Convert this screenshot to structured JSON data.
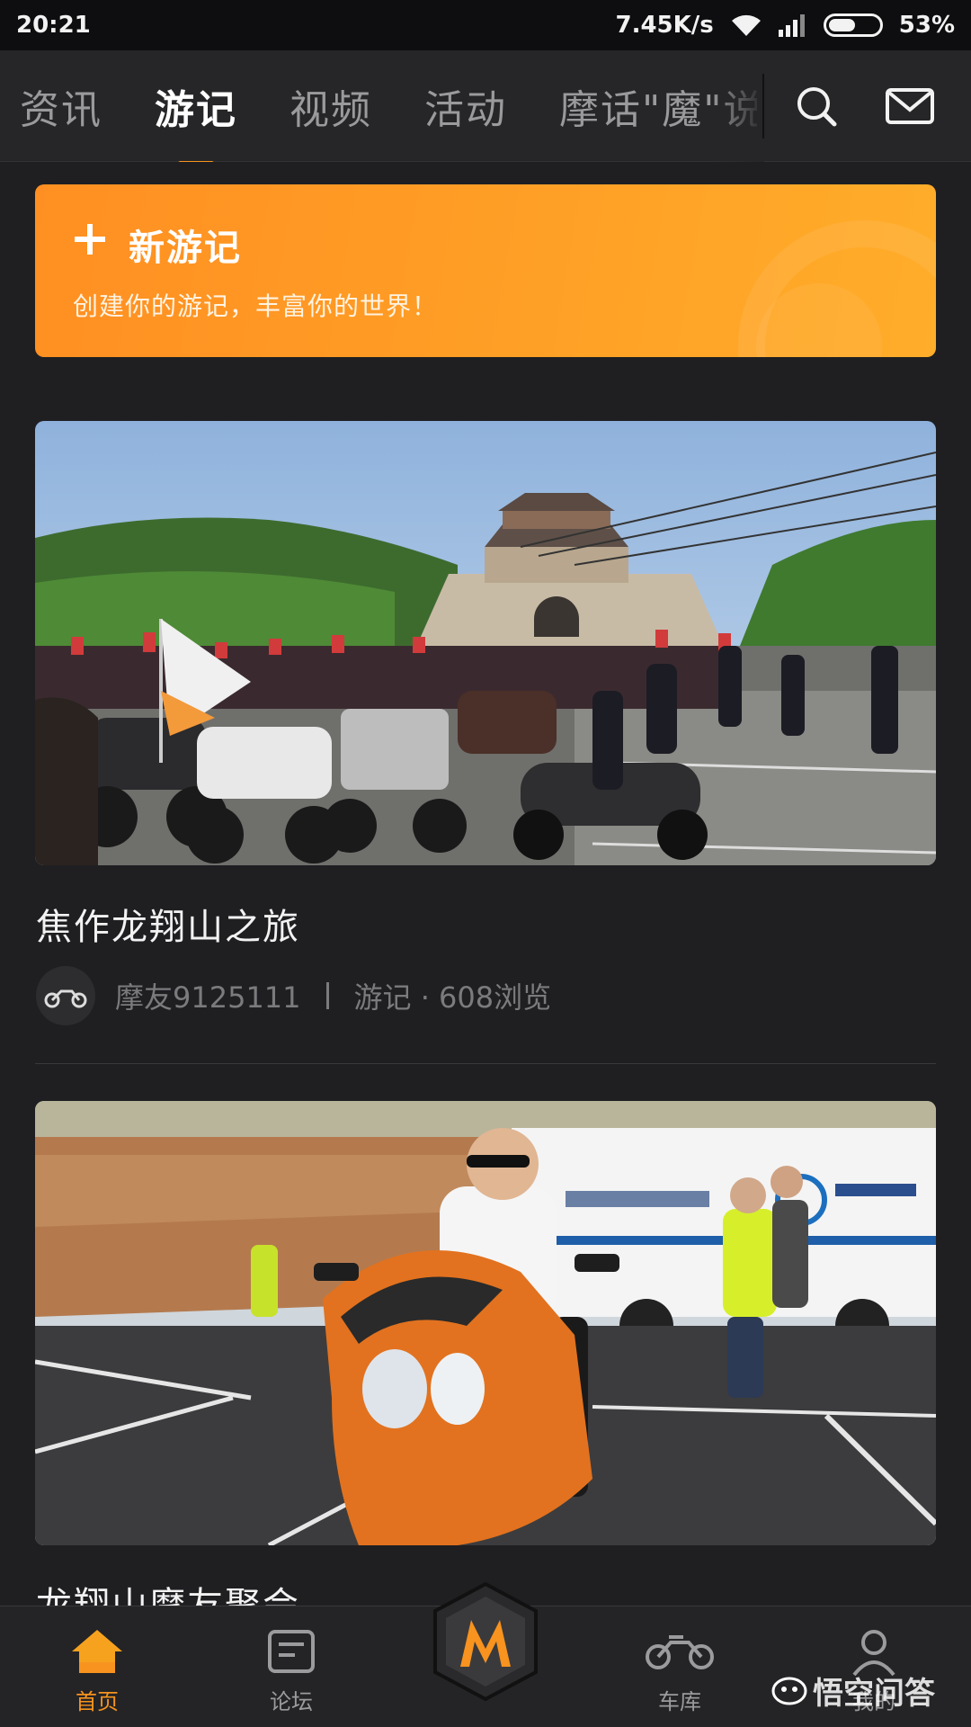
{
  "status_bar": {
    "time": "20:21",
    "network_speed": "7.45K/s",
    "battery_percent": "53%",
    "battery_level": 0.53
  },
  "top_nav": {
    "tabs": [
      {
        "label": "资讯"
      },
      {
        "label": "游记"
      },
      {
        "label": "视频"
      },
      {
        "label": "活动"
      },
      {
        "label": "摩话\"魔\"说"
      }
    ],
    "active_tab": "游记",
    "icons": [
      "search-icon",
      "mail-icon"
    ]
  },
  "banner": {
    "title": "新游记",
    "subtitle": "创建你的游记，丰富你的世界！"
  },
  "posts": [
    {
      "title": "焦作龙翔山之旅",
      "author": "摩友9125111",
      "category_views": "游记 · 608浏览",
      "image": "motorcycle-rally-photo"
    },
    {
      "title": "龙翔山摩友聚会",
      "image": "orange-motorcycle-photo"
    }
  ],
  "bottom_nav": {
    "items": [
      {
        "label": "首页",
        "icon": "home-icon",
        "active": true
      },
      {
        "label": "论坛",
        "icon": "forum-icon",
        "active": false
      },
      {
        "label": "",
        "icon": "m-logo-icon",
        "active": false
      },
      {
        "label": "车库",
        "icon": "motorcycle-icon",
        "active": false
      },
      {
        "label": "我的",
        "icon": "user-icon",
        "active": false
      }
    ]
  },
  "watermark": "悟空问答",
  "colors": {
    "accent": "#f7931e",
    "background": "#1f1f22",
    "nav_bg": "#262628"
  }
}
